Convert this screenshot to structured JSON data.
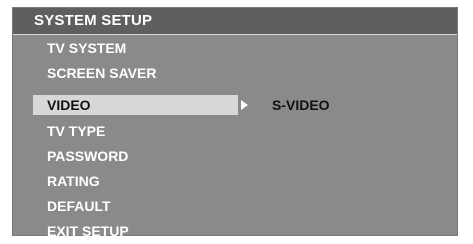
{
  "menu": {
    "title": "SYSTEM SETUP",
    "items": [
      {
        "label": "TV SYSTEM"
      },
      {
        "label": "SCREEN SAVER"
      },
      {
        "label": "VIDEO"
      },
      {
        "label": "TV TYPE"
      },
      {
        "label": "PASSWORD"
      },
      {
        "label": "RATING"
      },
      {
        "label": "DEFAULT"
      },
      {
        "label": "EXIT   SETUP"
      }
    ],
    "selected_index": 2
  },
  "submenu": {
    "arrow_icon": "triangle-right-icon",
    "value": "S-VIDEO"
  },
  "colors": {
    "panel": "#8a8a8a",
    "header": "#5f5f5f",
    "selection": "#d8d8d8",
    "text": "#ffffff",
    "selected_text": "#111111"
  }
}
